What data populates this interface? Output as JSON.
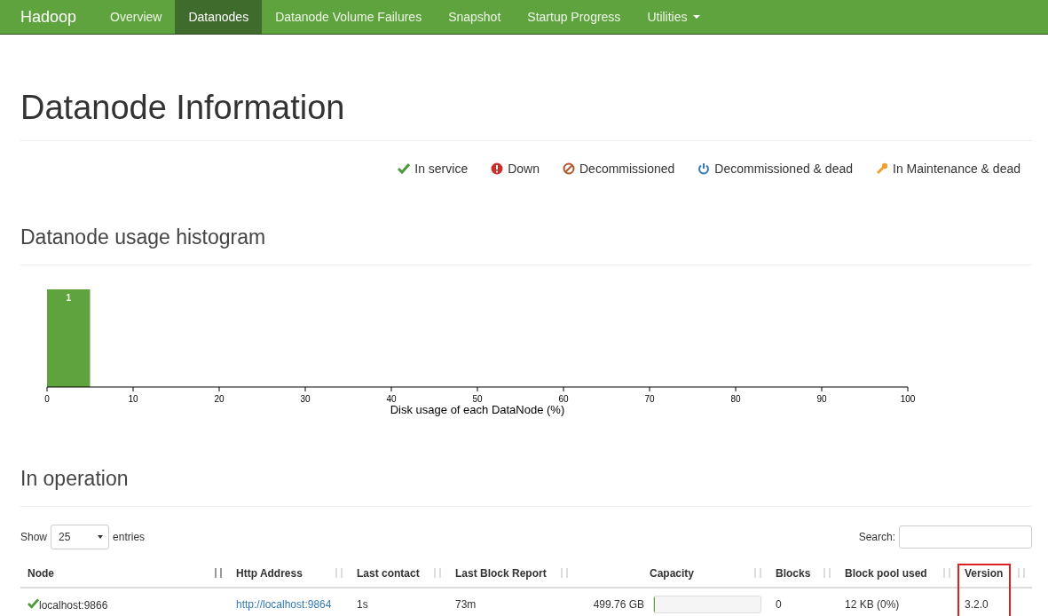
{
  "navbar": {
    "brand": "Hadoop",
    "items": [
      {
        "label": "Overview",
        "selected": false,
        "kind": "link"
      },
      {
        "label": "Datanodes",
        "selected": true,
        "kind": "link"
      },
      {
        "label": "Datanode Volume Failures",
        "selected": false,
        "kind": "link"
      },
      {
        "label": "Snapshot",
        "selected": false,
        "kind": "link"
      },
      {
        "label": "Startup Progress",
        "selected": false,
        "kind": "link"
      },
      {
        "label": "Utilities",
        "selected": false,
        "kind": "dropdown"
      }
    ]
  },
  "page_title": "Datanode Information",
  "legend": [
    {
      "label": "In service",
      "kind": "check",
      "color": "#4a9a3a"
    },
    {
      "label": "Down",
      "kind": "alert",
      "color": "#c9302c"
    },
    {
      "label": "Decommissioned",
      "kind": "ban",
      "color": "#b0562a"
    },
    {
      "label": "Decommissioned & dead",
      "kind": "power",
      "color": "#337ab7"
    },
    {
      "label": "In Maintenance & dead",
      "kind": "wrench",
      "color": "#f0a030"
    }
  ],
  "histogram": {
    "heading": "Datanode usage histogram",
    "chart_data": {
      "type": "bar",
      "xlabel": "Disk usage of each DataNode (%)",
      "x": [
        2.5
      ],
      "values": [
        1
      ],
      "xlim": [
        0,
        100
      ],
      "xticks": [
        0,
        10,
        20,
        30,
        40,
        50,
        60,
        70,
        80,
        90,
        100
      ],
      "data_labels": true
    }
  },
  "operation": {
    "heading": "In operation",
    "show_label": "Show",
    "page_size": "25",
    "entries_label": "entries",
    "search_label": "Search:",
    "columns": [
      {
        "label": "Node",
        "sorted": true,
        "highlighted": false
      },
      {
        "label": "Http Address",
        "sorted": false,
        "highlighted": false
      },
      {
        "label": "Last contact",
        "sorted": false,
        "highlighted": false
      },
      {
        "label": "Last Block Report",
        "sorted": false,
        "highlighted": false
      },
      {
        "label": "Capacity",
        "sorted": false,
        "highlighted": false
      },
      {
        "label": "Blocks",
        "sorted": false,
        "highlighted": false
      },
      {
        "label": "Block pool used",
        "sorted": false,
        "highlighted": false
      },
      {
        "label": "Version",
        "sorted": false,
        "highlighted": true
      }
    ],
    "rows": [
      {
        "node": "localhost:9866",
        "in_service": true,
        "http": "http://localhost:9864",
        "last_contact": "1s",
        "last_block_report": "73m",
        "capacity": "499.76 GB",
        "level": 0.01,
        "blocks": "0",
        "block_pool_used": "12 KB (0%)",
        "version": "3.2.0"
      }
    ]
  }
}
